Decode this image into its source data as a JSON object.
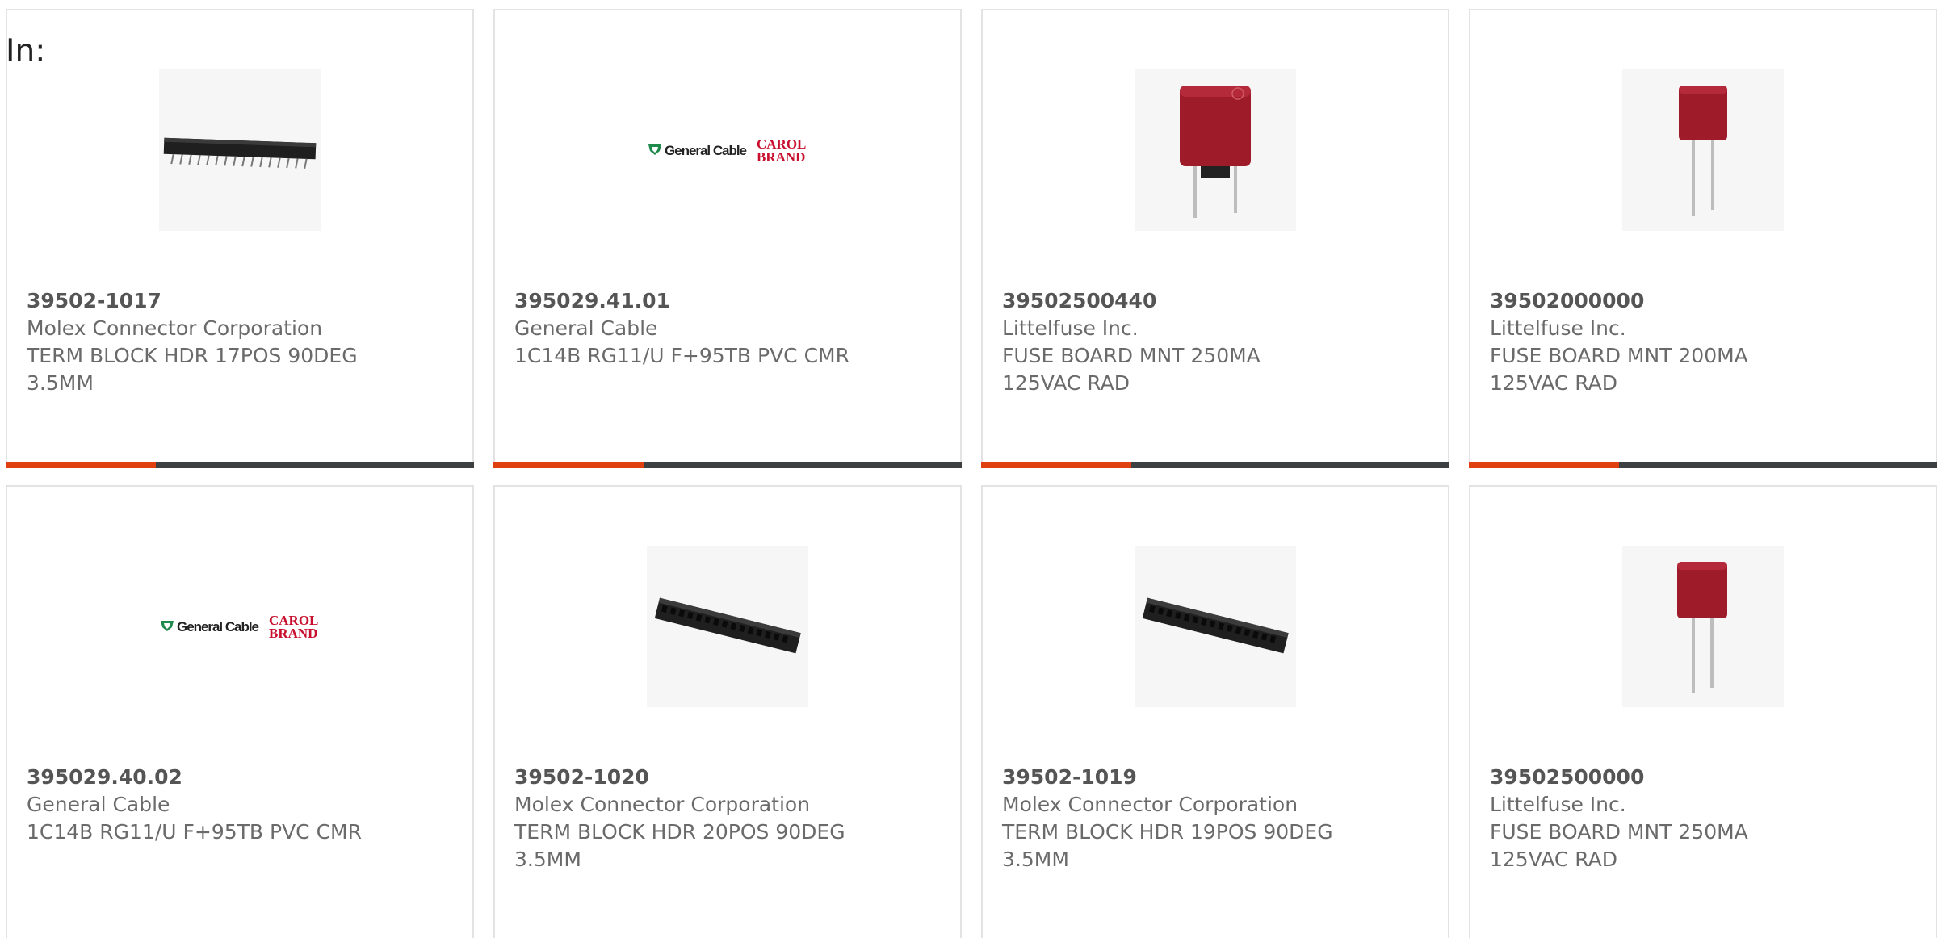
{
  "header": {
    "in_label": "In:"
  },
  "colors": {
    "accent": "#e0400f",
    "bar_track": "#3d4043",
    "card_border": "#e3e3e3"
  },
  "products": [
    {
      "part": "39502-1017",
      "maker": "Molex Connector Corporation",
      "desc1": "TERM BLOCK HDR 17POS 90DEG",
      "desc2": "3.5MM",
      "image": "header-connector-icon",
      "progress": 0.32
    },
    {
      "part": "395029.41.01",
      "maker": "General Cable",
      "desc1": "1C14B RG11/U F+95TB PVC CMR",
      "desc2": "",
      "image": "general-cable-logo",
      "progress": 0.32
    },
    {
      "part": "39502500440",
      "maker": "Littelfuse Inc.",
      "desc1": "FUSE BOARD MNT 250MA",
      "desc2": "125VAC RAD",
      "image": "fuse-icon",
      "progress": 0.32
    },
    {
      "part": "39502000000",
      "maker": "Littelfuse Inc.",
      "desc1": "FUSE BOARD MNT 200MA",
      "desc2": "125VAC RAD",
      "image": "fuse-icon",
      "progress": 0.32
    },
    {
      "part": "395029.40.02",
      "maker": "General Cable",
      "desc1": "1C14B RG11/U F+95TB PVC CMR",
      "desc2": "",
      "image": "general-cable-logo"
    },
    {
      "part": "39502-1020",
      "maker": "Molex Connector Corporation",
      "desc1": "TERM BLOCK HDR 20POS 90DEG",
      "desc2": "3.5MM",
      "image": "header-connector-icon"
    },
    {
      "part": "39502-1019",
      "maker": "Molex Connector Corporation",
      "desc1": "TERM BLOCK HDR 19POS 90DEG",
      "desc2": "3.5MM",
      "image": "header-connector-icon"
    },
    {
      "part": "39502500000",
      "maker": "Littelfuse Inc.",
      "desc1": "FUSE BOARD MNT 250MA",
      "desc2": "125VAC RAD",
      "image": "fuse-icon"
    }
  ],
  "logo_text": {
    "general_cable": "General Cable",
    "carol_line1": "CAROL",
    "carol_line2": "BRAND"
  }
}
